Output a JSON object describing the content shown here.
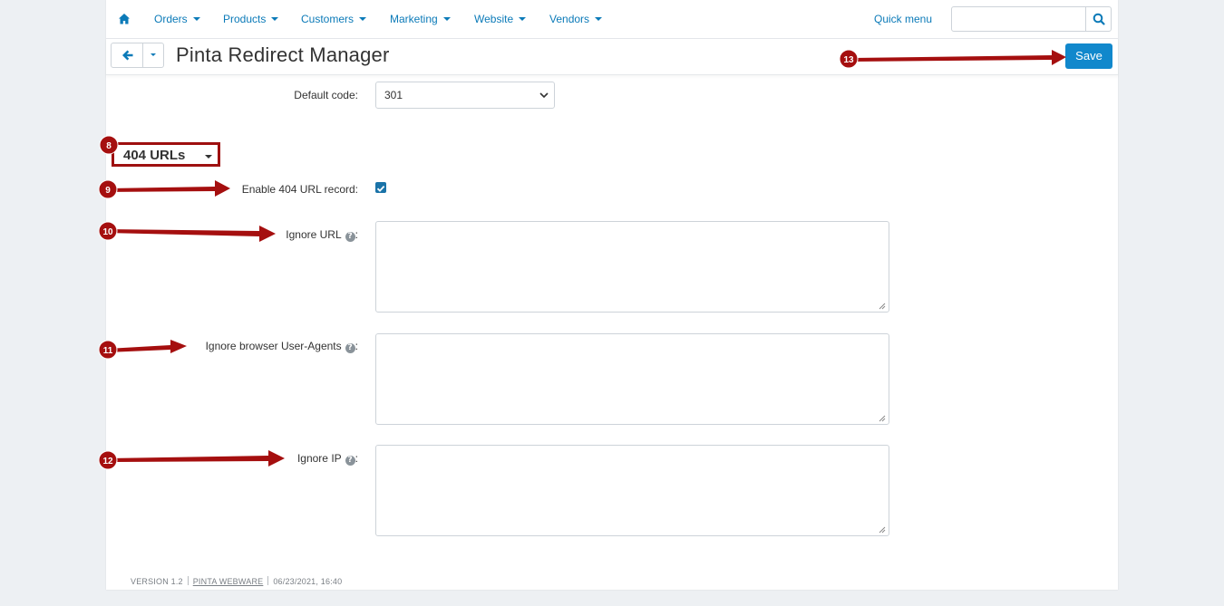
{
  "nav": {
    "home_icon": "home-icon",
    "items": [
      {
        "label": "Orders"
      },
      {
        "label": "Products"
      },
      {
        "label": "Customers"
      },
      {
        "label": "Marketing"
      },
      {
        "label": "Website"
      },
      {
        "label": "Vendors"
      }
    ],
    "quick_menu": "Quick menu",
    "search": {
      "value": "",
      "placeholder": "",
      "icon": "search-icon"
    }
  },
  "header": {
    "back_icon": "arrow-left-icon",
    "title": "Pinta Redirect Manager",
    "save_label": "Save"
  },
  "form": {
    "default_code": {
      "label": "Default code:",
      "value": "301"
    },
    "section_404": {
      "title": "404 URLs"
    },
    "enable_404": {
      "label": "Enable 404 URL record:",
      "checked": true
    },
    "ignore_url": {
      "label": "Ignore URL",
      "value": ""
    },
    "ignore_user_agents": {
      "label": "Ignore browser User-Agents",
      "value": ""
    },
    "ignore_ip": {
      "label": "Ignore IP",
      "value": ""
    },
    "colon": ":",
    "help_glyph": "?"
  },
  "footer": {
    "version": "VERSION 1.2",
    "vendor": "PINTA WEBWARE",
    "timestamp": "06/23/2021, 16:40"
  },
  "annotations": {
    "color": "#a50f0f",
    "markers": [
      {
        "number": "8"
      },
      {
        "number": "9"
      },
      {
        "number": "10"
      },
      {
        "number": "11"
      },
      {
        "number": "12"
      },
      {
        "number": "13"
      }
    ]
  },
  "colors": {
    "link": "#0b7ab8",
    "primary_button": "#1188cc",
    "checkbox": "#1a73a8",
    "page_background": "#edf0f3"
  }
}
